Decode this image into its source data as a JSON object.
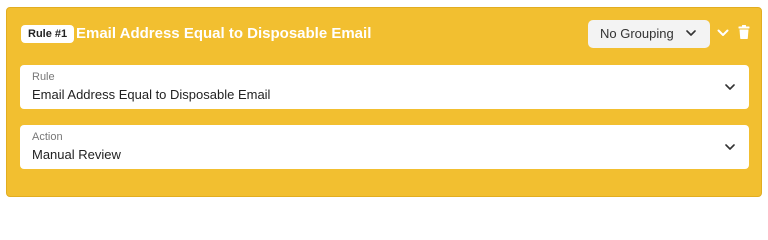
{
  "rule_card": {
    "badge": "Rule #1",
    "title": "Email Address Equal to Disposable Email",
    "grouping": {
      "selected": "No Grouping",
      "icon": "chevron-down-icon"
    },
    "collapse_icon": "chevron-down-icon",
    "delete_icon": "trash-icon",
    "colors": {
      "card_background": "#f2bf30",
      "title_text": "#ffffff",
      "field_background": "#ffffff"
    }
  },
  "fields": {
    "rule": {
      "label": "Rule",
      "value": "Email Address Equal to Disposable Email"
    },
    "action": {
      "label": "Action",
      "value": "Manual Review"
    }
  }
}
